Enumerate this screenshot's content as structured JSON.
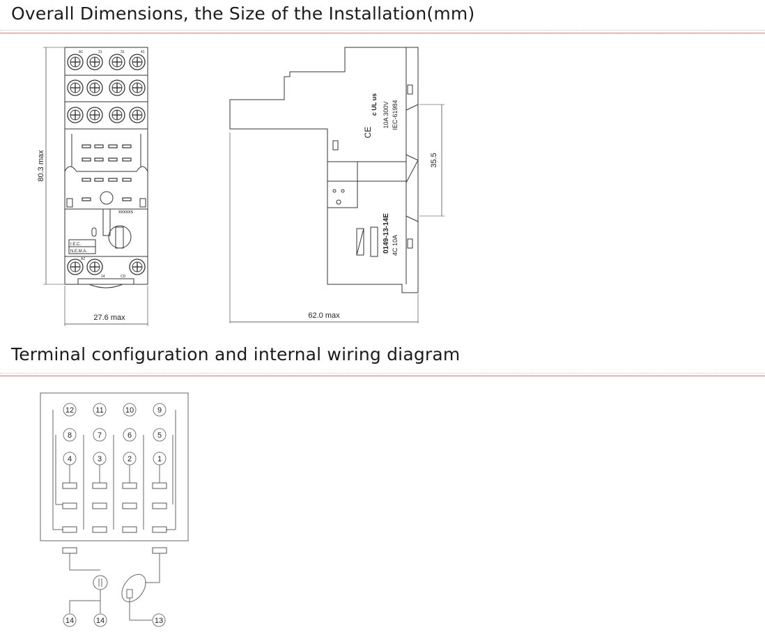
{
  "sections": {
    "dimensions_title": "Overall Dimensions, the Size of the Installation(mm)",
    "wiring_title": "Terminal configuration and internal wiring diagram"
  },
  "front_view": {
    "height_dim": "80.3 max",
    "width_dim": "27.6 max",
    "marking": "xxxxxs",
    "ie_label": "I.E.C.",
    "nema_label": "N.E.M.A.",
    "terminal_labels_top": [
      "A1",
      "21",
      "31",
      "41"
    ],
    "terminal_label_a2": "A2",
    "terminal_label_14": "14",
    "terminal_label_cd": "CD"
  },
  "side_view": {
    "depth_dim": "62.0 max",
    "rail_dim": "35.5",
    "rating": "10A 300V",
    "standard": "IEC-61984",
    "ul_mark": "c UL us",
    "ce_mark": "CE",
    "model": "0149-13-14E",
    "contact": "4C 10A"
  },
  "wiring": {
    "row1": [
      "12",
      "11",
      "10",
      "9"
    ],
    "row2": [
      "8",
      "7",
      "6",
      "5"
    ],
    "row3": [
      "4",
      "3",
      "2",
      "1"
    ],
    "bottom": [
      "14",
      "14",
      "13"
    ]
  },
  "colors": {
    "line": "#333333",
    "light_line": "#777777",
    "rule": "#c87a7a"
  }
}
